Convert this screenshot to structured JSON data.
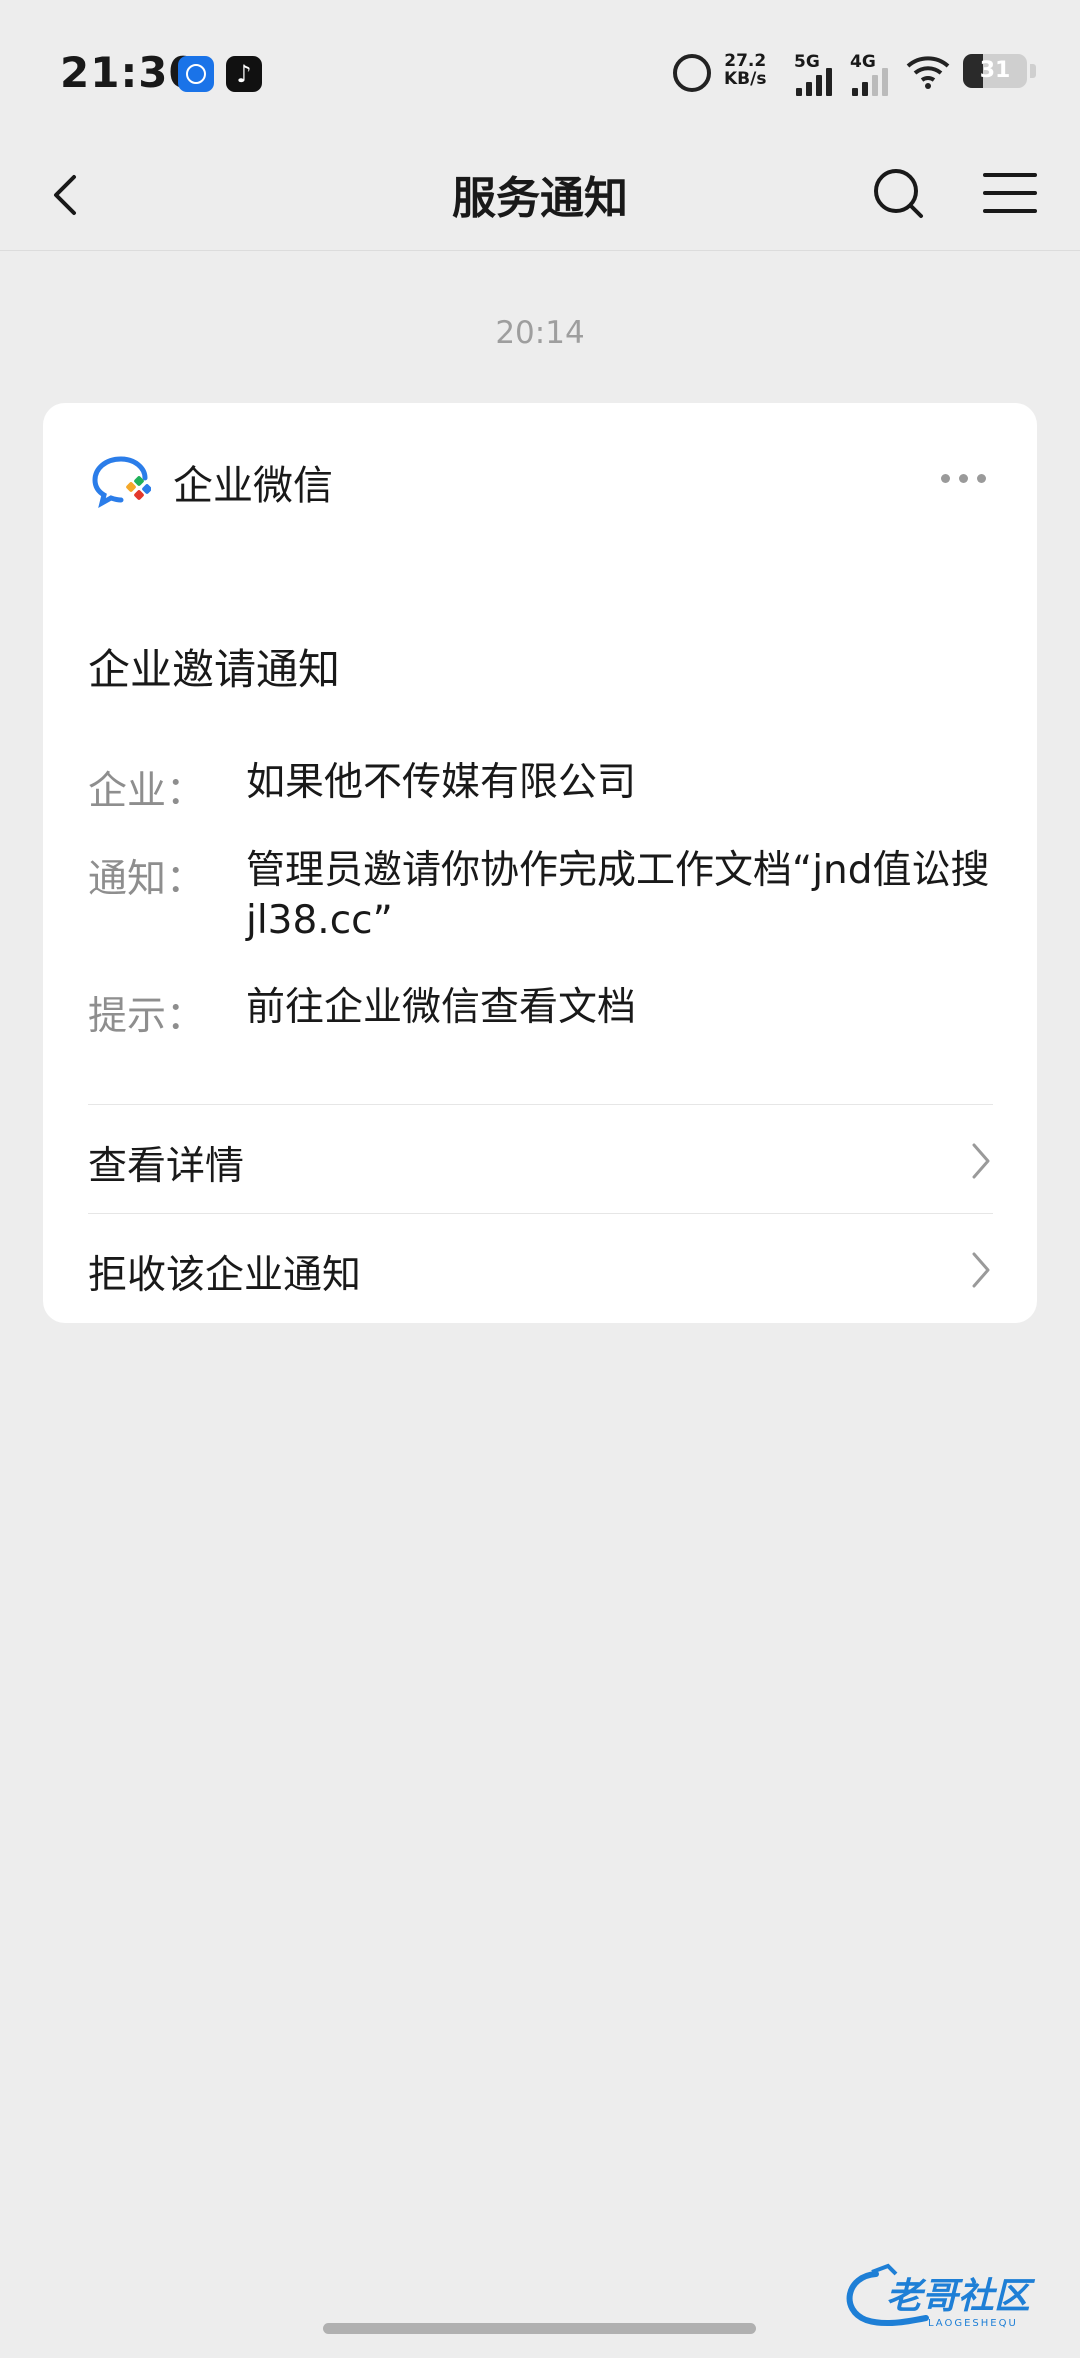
{
  "status_bar": {
    "time": "21:30",
    "speed_value": "27.2",
    "speed_unit": "KB/s",
    "network_1": "5G",
    "network_2": "4G",
    "battery": "31",
    "battery_level": 0.31
  },
  "header": {
    "title": "服务通知",
    "back_icon": "chevron-left-icon",
    "search_icon": "search-icon",
    "menu_icon": "menu-icon"
  },
  "message": {
    "timestamp": "20:14",
    "app_name": "企业微信",
    "title": "企业邀请通知",
    "fields": [
      {
        "label": "企业：",
        "value": "如果他不传媒有限公司"
      },
      {
        "label": "通知：",
        "value": "管理员邀请你协作完成工作文档“jnd值讼搜jl38.cc”"
      },
      {
        "label": "提示：",
        "value": "前往企业微信查看文档"
      }
    ],
    "actions": [
      {
        "label": "查看详情"
      },
      {
        "label": "拒收该企业通知"
      }
    ]
  },
  "colors": {
    "background": "#ededed",
    "card": "#ffffff",
    "brand_blue": "#2b7de9",
    "muted": "#8e8e8e"
  },
  "watermark": {
    "text": "老哥社区",
    "subtext": "LAOGESHEQU"
  }
}
